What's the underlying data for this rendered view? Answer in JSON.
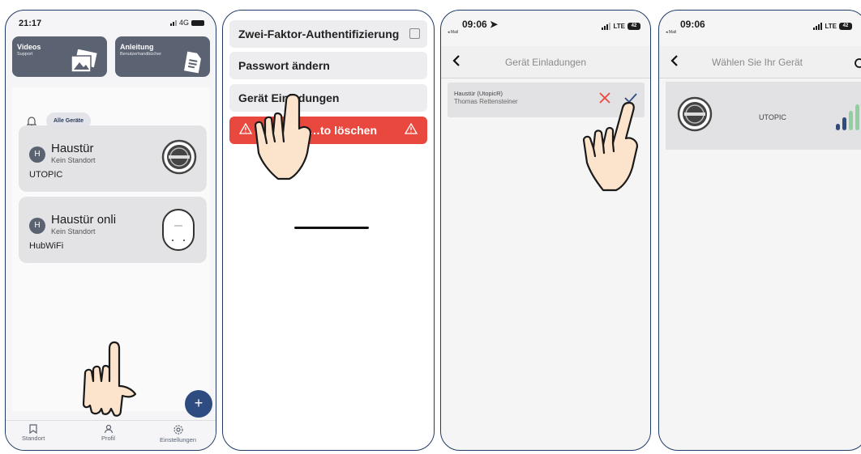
{
  "phone1": {
    "status": {
      "time": "21:17",
      "network": "4G"
    },
    "tiles": [
      {
        "title": "Videos",
        "subtitle": "Support"
      },
      {
        "title": "Anleitung",
        "subtitle": "Benutzerhandbücher"
      }
    ],
    "filter_chip": "Alle Geräte",
    "devices": [
      {
        "avatar": "H",
        "name": "Haustür",
        "location": "Kein Standort",
        "model": "UTOPIC",
        "icon": "utopic-lock-icon"
      },
      {
        "avatar": "H",
        "name": "Haustür onli",
        "location": "Kein Standort",
        "model": "HubWiFi",
        "icon": "hub-wifi-icon"
      }
    ],
    "fab_label": "+",
    "nav": [
      {
        "label": "Standort",
        "icon": "bookmark-icon"
      },
      {
        "label": "Profil",
        "icon": "person-icon"
      },
      {
        "label": "Einstellungen",
        "icon": "gear-icon"
      }
    ]
  },
  "phone2": {
    "menu": [
      {
        "label": "Zwei-Faktor-Authentifizierung",
        "type": "checkbox"
      },
      {
        "label": "Passwort ändern"
      },
      {
        "label": "Gerät Einladungen"
      },
      {
        "label": "…to löschen",
        "type": "danger"
      }
    ],
    "colors": {
      "danger": "#e8483e"
    }
  },
  "phone3": {
    "status": {
      "time": "09:06",
      "back_app": "◂ Mail",
      "network": "LTE",
      "battery": "42"
    },
    "title": "Gerät Einladungen",
    "invite": {
      "device": "Haustür (UtopicR)",
      "from": "Thomas Rettensteiner"
    },
    "colors": {
      "reject": "#e8483e",
      "accept": "#2f4c80"
    }
  },
  "phone4": {
    "status": {
      "time": "09:06",
      "back_app": "◂ Mail",
      "network": "LTE",
      "battery": "42"
    },
    "title": "Wählen Sie Ihr Gerät",
    "device": {
      "name": "UTOPIC",
      "icon": "utopic-lock-icon",
      "signal": "signal-strength-icon"
    },
    "colors": {
      "signal_dark": "#2f4c80",
      "signal_light": "#8fd19e"
    }
  }
}
